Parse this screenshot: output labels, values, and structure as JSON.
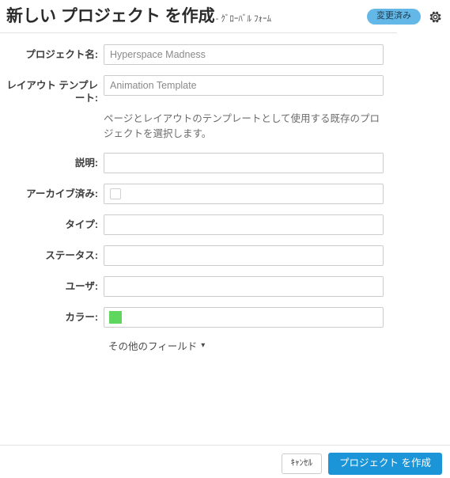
{
  "header": {
    "title": "新しい プロジェクト を作成",
    "subtitle": "- ｸﾞﾛｰﾊﾞﾙ ﾌｫｰﾑ",
    "status_badge": "変更済み",
    "badge_color": "#63b8e8",
    "gear_icon": "gear-icon"
  },
  "form": {
    "fields": [
      {
        "label": "プロジェクト名:",
        "type": "text",
        "value": "Hyperspace Madness",
        "placeholder": "Hyperspace Madness"
      },
      {
        "label": "レイアウト テンプレート:",
        "type": "text",
        "value": "Animation Template",
        "placeholder": "Animation Template",
        "help": "ページとレイアウトのテンプレートとして使用する既存のプロジェクトを選択します。"
      },
      {
        "label": "説明:",
        "type": "text",
        "value": "",
        "placeholder": ""
      },
      {
        "label": "アーカイブ済み:",
        "type": "checkbox",
        "checked": false
      },
      {
        "label": "タイプ:",
        "type": "text",
        "value": "",
        "placeholder": ""
      },
      {
        "label": "ステータス:",
        "type": "text",
        "value": "",
        "placeholder": ""
      },
      {
        "label": "ユーザ:",
        "type": "text",
        "value": "",
        "placeholder": ""
      },
      {
        "label": "カラー:",
        "type": "color",
        "value": "#5fd75f"
      }
    ],
    "more_fields_label": "その他のフィールド",
    "more_fields_chevron": "chevron-down-icon"
  },
  "footer": {
    "cancel_label": "ｷｬﾝｾﾙ",
    "submit_label": "プロジェクト を作成",
    "submit_color": "#1b95d8"
  }
}
